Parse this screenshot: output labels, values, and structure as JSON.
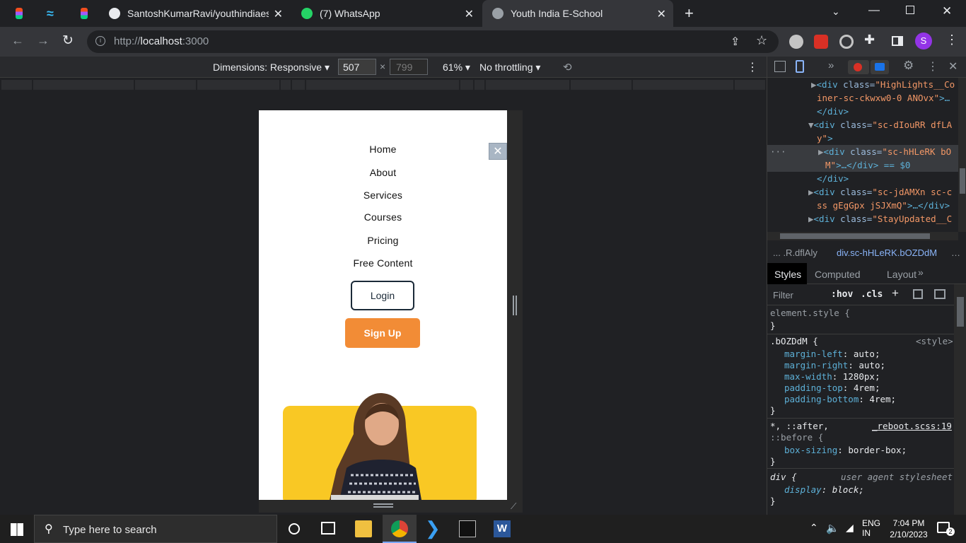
{
  "browser": {
    "tabs": [
      {
        "title": "",
        "favicon": "figma-icon"
      },
      {
        "title": "",
        "favicon": "tailwind-icon"
      },
      {
        "title": "",
        "favicon": "figma-icon"
      },
      {
        "title": "SantoshKumarRavi/youthindiaesc",
        "favicon": "github-icon"
      },
      {
        "title": "(7) WhatsApp",
        "favicon": "whatsapp-icon"
      },
      {
        "title": "Youth India E-School",
        "favicon": "globe-icon",
        "active": true
      }
    ],
    "url_prefix": "http://",
    "url_host": "localhost",
    "url_port": ":3000",
    "profile_initial": "S"
  },
  "device_toolbar": {
    "dimensions_label": "Dimensions: Responsive",
    "width": "507",
    "height": "799",
    "zoom": "61%",
    "throttling": "No throttling"
  },
  "page": {
    "nav_items": [
      "Home",
      "About",
      "Services",
      "Courses",
      "Pricing",
      "Free Content"
    ],
    "login_label": "Login",
    "signup_label": "Sign Up",
    "close_glyph": "✕"
  },
  "devtools": {
    "elements_lines": [
      {
        "prefix": "▶",
        "tag_open": "<div ",
        "attr": "class=",
        "value": "\"HighLights__Co"
      },
      {
        "prefix": " ",
        "tag_open": "",
        "attr": "",
        "value": "iner-sc-ckwxw0-0 ANOvx\"",
        "suffix": ">…"
      },
      {
        "prefix": " ",
        "tag_open": "</div>",
        "attr": "",
        "value": ""
      },
      {
        "prefix": "▼",
        "tag_open": "<div ",
        "attr": "class=",
        "value": "\"sc-dIouRR dfLA"
      },
      {
        "prefix": " ",
        "tag_open": "",
        "attr": "",
        "value": "y\"",
        "suffix": ">"
      },
      {
        "prefix": "▶",
        "tag_open": "<div ",
        "attr": "class=",
        "value": "\"sc-hHLeRK bO"
      },
      {
        "prefix": " ",
        "tag_open": "",
        "attr": "",
        "value": "M\"",
        "suffix": ">…</div> == $0"
      },
      {
        "prefix": " ",
        "tag_open": "</div>",
        "attr": "",
        "value": ""
      },
      {
        "prefix": "▶",
        "tag_open": "<div ",
        "attr": "class=",
        "value": "\"sc-jdAMXn sc-c"
      },
      {
        "prefix": " ",
        "tag_open": "",
        "attr": "",
        "value": "ss gEgGpx jSJXmQ\"",
        "suffix": ">…</div>"
      },
      {
        "prefix": "▶",
        "tag_open": "<div ",
        "attr": "class=",
        "value": "\"StayUpdated__C"
      }
    ],
    "breadcrumb_left": "...  .R.dflAly",
    "breadcrumb_right": "div.sc-hHLeRK.bOZDdM",
    "style_tabs": [
      "Styles",
      "Computed",
      "Layout"
    ],
    "filter_placeholder": "Filter",
    "hov": ":hov",
    "cls": ".cls",
    "style_rules": [
      {
        "selector": "element.style {",
        "origin": "",
        "props": [],
        "close": "}"
      },
      {
        "selector": ".bOZDdM {",
        "origin": "<style>",
        "props": [
          [
            "margin-left",
            "auto;"
          ],
          [
            "margin-right",
            "auto;"
          ],
          [
            "max-width",
            "1280px;"
          ],
          [
            "padding-top",
            "4rem;"
          ],
          [
            "padding-bottom",
            "4rem;"
          ]
        ],
        "close": "}"
      },
      {
        "selector": "*, ::after,",
        "origin": "_reboot.scss:19",
        "selector2": "::before {",
        "props": [
          [
            "box-sizing",
            "border-box;"
          ]
        ],
        "close": "}"
      },
      {
        "selector": "div {",
        "origin": "user agent stylesheet",
        "props": [
          [
            "display",
            "block;"
          ]
        ],
        "close": "}"
      }
    ]
  },
  "taskbar": {
    "search_placeholder": "Type here to search",
    "lang_top": "ENG",
    "lang_bottom": "IN",
    "time": "7:04 PM",
    "date": "2/10/2023",
    "notification_count": "2"
  }
}
